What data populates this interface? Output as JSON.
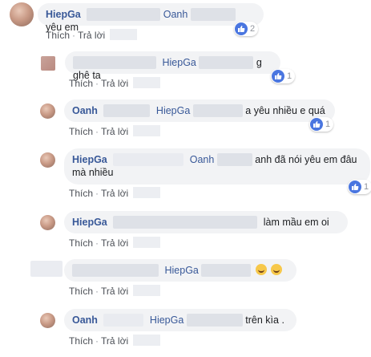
{
  "actions": {
    "like": "Thích",
    "reply": "Trả lời",
    "separator": "·"
  },
  "comments": [
    {
      "name": "HiepGa",
      "mention": "Oanh",
      "text": "yêu em",
      "reactions": "2"
    },
    {
      "mention": "HiepGa",
      "text": "g ghê ta",
      "reactions": "1"
    },
    {
      "name": "Oanh",
      "mention": "HiepGa",
      "text": "a yêu nhiều e quá",
      "reactions": "1"
    },
    {
      "name": "HiepGa",
      "mention": "Oanh",
      "text": "anh đã nói yêu em đâu",
      "text2": "mà nhiều",
      "reactions": "1"
    },
    {
      "name": "HiepGa",
      "text": "làm mầu em oi"
    },
    {
      "mention": "HiepGa"
    },
    {
      "name": "Oanh",
      "mention": "HiepGa",
      "text": "trên kìa ."
    }
  ],
  "colors": {
    "link": "#385898",
    "bubble": "#f2f3f5",
    "like": "#4a76e0"
  }
}
